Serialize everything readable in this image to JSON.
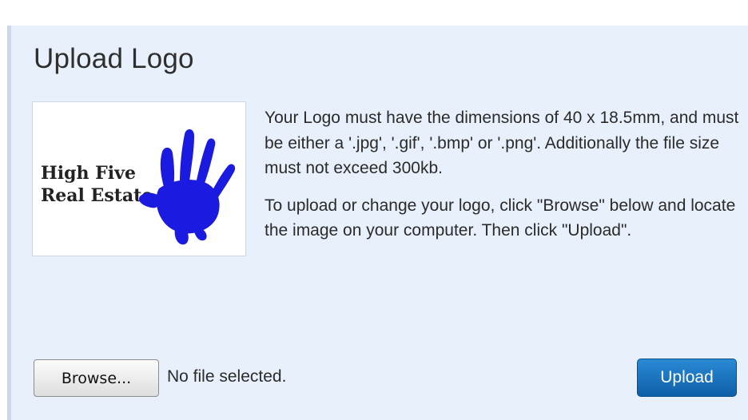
{
  "section": {
    "title": "Upload Logo"
  },
  "logo": {
    "line1": "High Five",
    "line2": "Real Estate",
    "hand_color": "#1a1ae0",
    "icon": "hand-print-icon"
  },
  "instructions": {
    "paragraph1": "Your Logo must have the dimensions of 40 x 18.5mm, and must be either a '.jpg', '.gif', '.bmp' or '.png'. Additionally the file size must not exceed 300kb.",
    "paragraph2": "To upload or change your logo, click \"Browse\" below and locate the image on your computer. Then click \"Upload\"."
  },
  "file_input": {
    "browse_label": "Browse...",
    "status": "No file selected."
  },
  "actions": {
    "upload_label": "Upload"
  },
  "colors": {
    "panel_bg": "#e8f0fb",
    "accent": "#0d5fa8"
  }
}
